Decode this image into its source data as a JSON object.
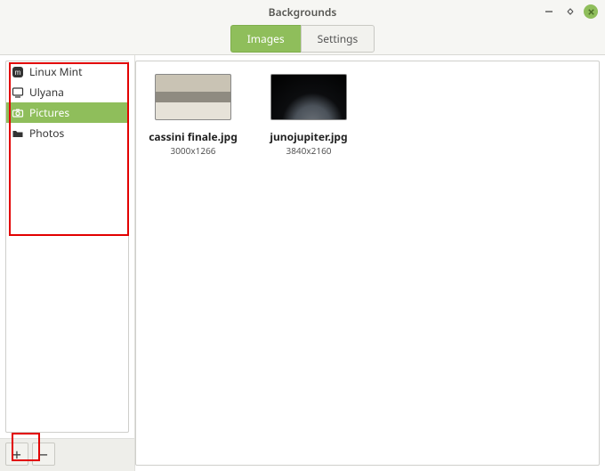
{
  "window": {
    "title": "Backgrounds"
  },
  "tabs": {
    "images": "Images",
    "settings": "Settings",
    "active": "images"
  },
  "sidebar": {
    "items": [
      {
        "label": "Linux Mint",
        "icon": "mint-logo-icon",
        "selected": false
      },
      {
        "label": "Ulyana",
        "icon": "monitor-icon",
        "selected": false
      },
      {
        "label": "Pictures",
        "icon": "camera-icon",
        "selected": true
      },
      {
        "label": "Photos",
        "icon": "folder-icon",
        "selected": false
      }
    ]
  },
  "buttons": {
    "add": "+",
    "remove": "−"
  },
  "gallery": {
    "items": [
      {
        "filename": "cassini finale.jpg",
        "resolution": "3000x1266",
        "thumb": "cassini"
      },
      {
        "filename": "junojupiter.jpg",
        "resolution": "3840x2160",
        "thumb": "juno"
      }
    ]
  },
  "colors": {
    "accent": "#8fbe5b"
  }
}
